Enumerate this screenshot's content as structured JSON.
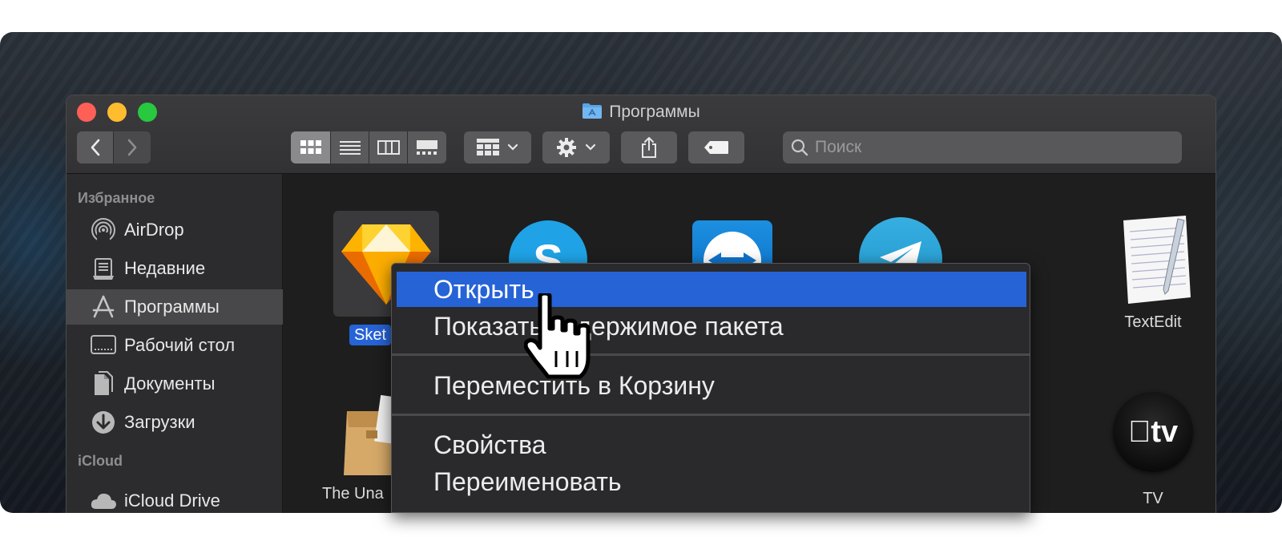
{
  "window": {
    "title": "Программы"
  },
  "toolbar": {
    "search_placeholder": "Поиск"
  },
  "sidebar": {
    "sections": [
      {
        "heading": "Избранное"
      },
      {
        "heading": "iCloud"
      }
    ],
    "items": [
      {
        "label": "AirDrop",
        "icon": "airdrop-icon"
      },
      {
        "label": "Недавние",
        "icon": "recents-icon"
      },
      {
        "label": "Программы",
        "icon": "applications-icon",
        "selected": true
      },
      {
        "label": "Рабочий стол",
        "icon": "desktop-icon"
      },
      {
        "label": "Документы",
        "icon": "documents-icon"
      },
      {
        "label": "Загрузки",
        "icon": "downloads-icon"
      },
      {
        "label": "iCloud Drive",
        "icon": "icloud-icon"
      }
    ]
  },
  "apps": [
    {
      "label": "Sket",
      "icon": "sketch-icon",
      "selected": true
    },
    {
      "label": "",
      "icon": "skype-icon"
    },
    {
      "label": "",
      "icon": "teamviewer-icon"
    },
    {
      "label": "",
      "icon": "telegram-icon"
    },
    {
      "label": "TextEdit",
      "icon": "textedit-icon"
    },
    {
      "label": "The Una",
      "icon": "unarchiver-icon"
    },
    {
      "label": "TV",
      "icon": "apple-tv-icon"
    }
  ],
  "context_menu": {
    "items": [
      {
        "label": "Открыть",
        "highlighted": true
      },
      {
        "label": "Показать содержимое пакета"
      },
      {
        "label": "Переместить в Корзину"
      },
      {
        "label": "Свойства"
      },
      {
        "label": "Переименовать"
      }
    ]
  },
  "colors": {
    "menu_highlight": "#2663d7",
    "selected_label": "#2663d7",
    "close": "#fe5f57",
    "minimize": "#febc2e",
    "maximize": "#28c840"
  }
}
